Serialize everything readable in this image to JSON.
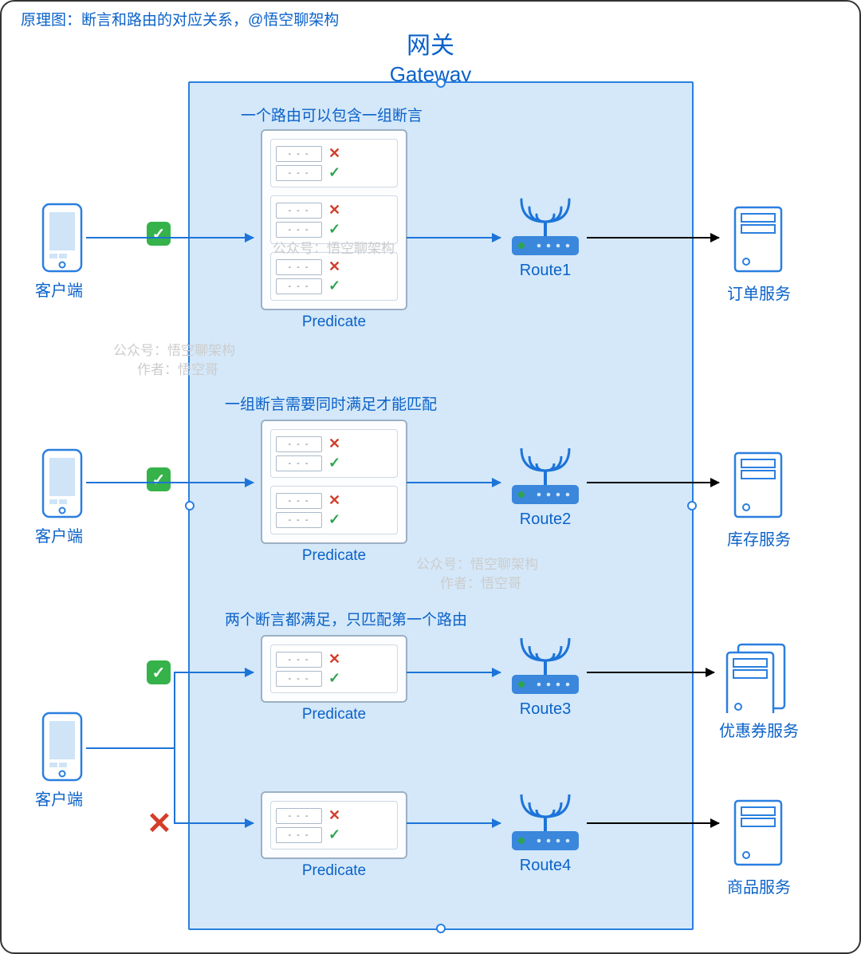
{
  "header": "原理图：断言和路由的对应关系，@悟空聊架构",
  "gateway": {
    "cn": "网关",
    "en": "Gateway"
  },
  "sections": {
    "s1": "一个路由可以包含一组断言",
    "s2": "一组断言需要同时满足才能匹配",
    "s3": "两个断言都满足，只匹配第一个路由"
  },
  "predicateLabel": "Predicate",
  "clientLabel": "客户端",
  "routes": {
    "r1": "Route1",
    "r2": "Route2",
    "r3": "Route3",
    "r4": "Route4"
  },
  "services": {
    "sv1": "订单服务",
    "sv2": "库存服务",
    "sv3": "优惠券服务",
    "sv4": "商品服务"
  },
  "marks": {
    "ok": "✓",
    "no": "✕",
    "checkbadge": "✓",
    "dashes": "- - -"
  },
  "predicateGroups": {
    "p1": [
      [
        "no",
        "ok"
      ],
      [
        "no",
        "ok"
      ],
      [
        "no",
        "ok"
      ]
    ],
    "p2": [
      [
        "no",
        "ok"
      ],
      [
        "no",
        "ok"
      ]
    ],
    "p3": [
      [
        "no",
        "ok"
      ]
    ],
    "p4": [
      [
        "no",
        "ok"
      ]
    ]
  },
  "watermarks": {
    "line1": "公众号：悟空聊架构",
    "line2": "作者：悟空哥"
  }
}
